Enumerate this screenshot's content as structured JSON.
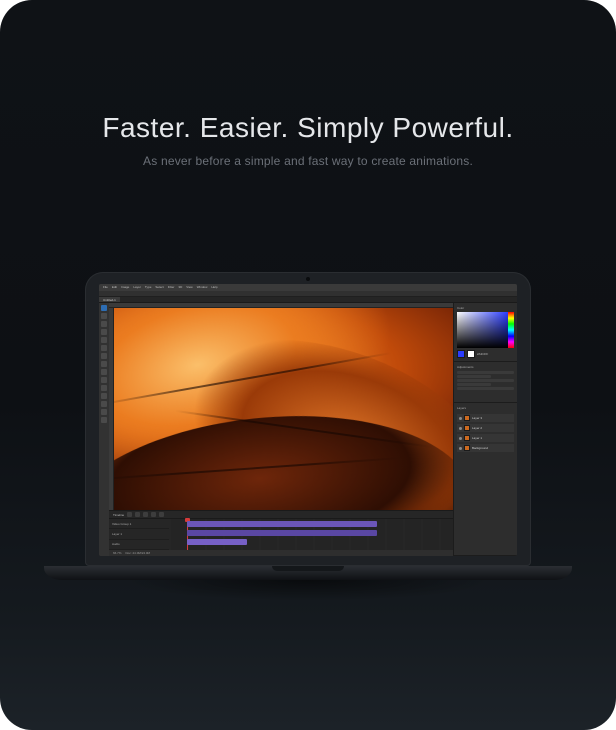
{
  "hero": {
    "headline": "Faster. Easier. Simply Powerful.",
    "subline": "As never before a simple and fast way to create animations."
  },
  "editor": {
    "menu": [
      "File",
      "Edit",
      "Image",
      "Layer",
      "Type",
      "Select",
      "Filter",
      "3D",
      "View",
      "Window",
      "Help"
    ],
    "document_tab": "Untitled-1",
    "panels": {
      "color_title": "Color",
      "color_hex": "2A3CFF",
      "adjust_title": "Adjustments",
      "layers_title": "Layers",
      "layers": [
        "Background",
        "Layer 1",
        "Layer 2",
        "Layer 3"
      ]
    },
    "timeline": {
      "title": "Timeline",
      "tracks": [
        "Video Group 1",
        "Layer 1",
        "Audio"
      ]
    },
    "status": {
      "zoom": "66.7%",
      "info": "Doc: 24.0M/24.0M"
    }
  }
}
